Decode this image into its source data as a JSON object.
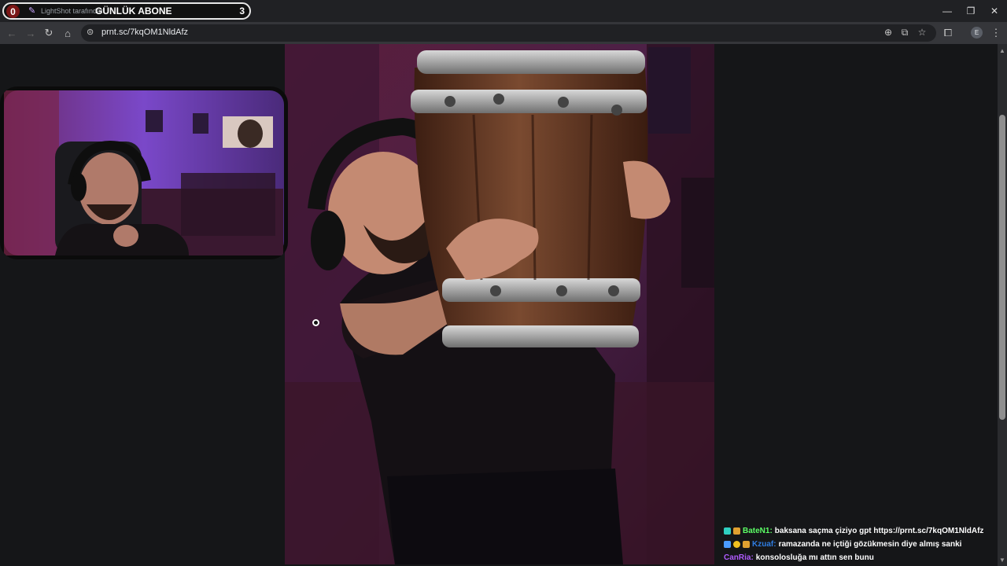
{
  "tab": {
    "left_count": "0",
    "title": "LightShot tarafından",
    "overlay_title": "GÜNLÜK ABONE",
    "right_count": "3",
    "favicon": "feather-icon"
  },
  "window_controls": {
    "minimize": "—",
    "restore": "❐",
    "close": "✕"
  },
  "toolbar": {
    "back": "←",
    "forward": "→",
    "reload": "↻",
    "home": "⌂",
    "site_info": "⊜",
    "url": "prnt.sc/7kqOM1NldAfz",
    "zoom_icon": "⊕",
    "install_icon": "⧉",
    "bookmark_icon": "☆",
    "extensions_icon": "⧠",
    "profile": "E",
    "menu_icon": "⋮"
  },
  "chat": [
    {
      "user": "BateN1:",
      "user_color": "#5cff66",
      "message": "baksana saçma çiziyo gpt https://prnt.sc/7kqOM1NldAfz"
    },
    {
      "user": "Kzuaf:",
      "user_color": "#2f7de1",
      "message": "ramazanda ne içtiği gözükmesin diye almış sanki"
    },
    {
      "user": "CanRia:",
      "user_color": "#b05cff",
      "message": "konsolosluğa mı attın sen bunu"
    }
  ],
  "colors": {
    "accent": "#7a1616",
    "chrome_bg": "#202124",
    "toolbar_bg": "#35363a"
  }
}
